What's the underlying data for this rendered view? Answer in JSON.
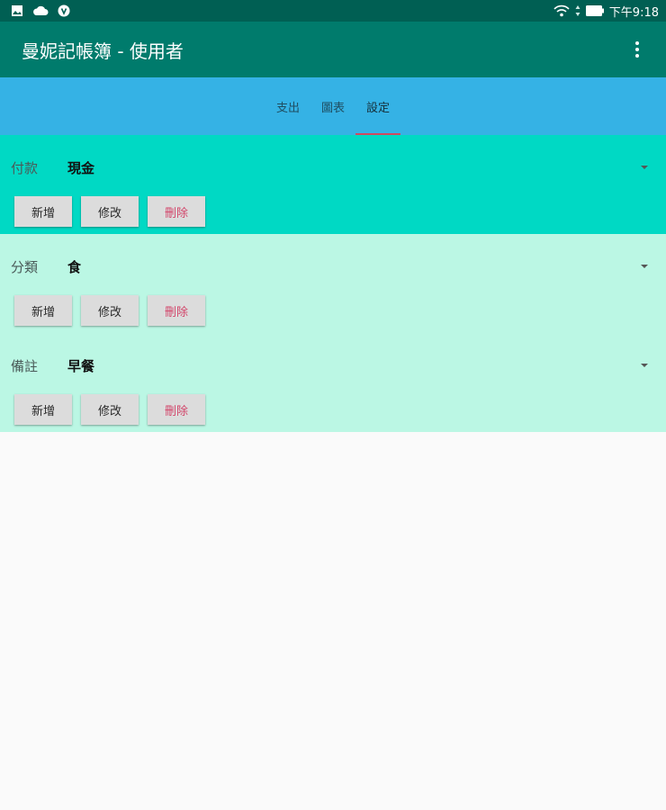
{
  "status_bar": {
    "time": "下午9:18",
    "left_icons": [
      "image-icon",
      "cloud-icon",
      "vpn-shield-icon"
    ],
    "right_icons": [
      "wifi-icon",
      "signal-icon",
      "battery-icon"
    ]
  },
  "app_bar": {
    "title": "曼妮記帳簿 - 使用者",
    "overflow_icon": "more-vert-icon"
  },
  "tabs": [
    {
      "label": "支出",
      "active": false
    },
    {
      "label": "圖表",
      "active": false
    },
    {
      "label": "設定",
      "active": true
    }
  ],
  "sections": {
    "payment": {
      "label": "付款",
      "value": "現金"
    },
    "category": {
      "label": "分類",
      "value": "食"
    },
    "note": {
      "label": "備註",
      "value": "早餐"
    }
  },
  "buttons": {
    "add": "新增",
    "edit": "修改",
    "delete": "刪除"
  },
  "colors": {
    "status_bar": "#005f53",
    "app_bar": "#007b6c",
    "tab_bar": "#35b2e5",
    "tab_indicator": "#d2485e",
    "payment_section": "#00d9c4",
    "category_section": "#bbf7e4",
    "delete_text": "#d2456a"
  }
}
